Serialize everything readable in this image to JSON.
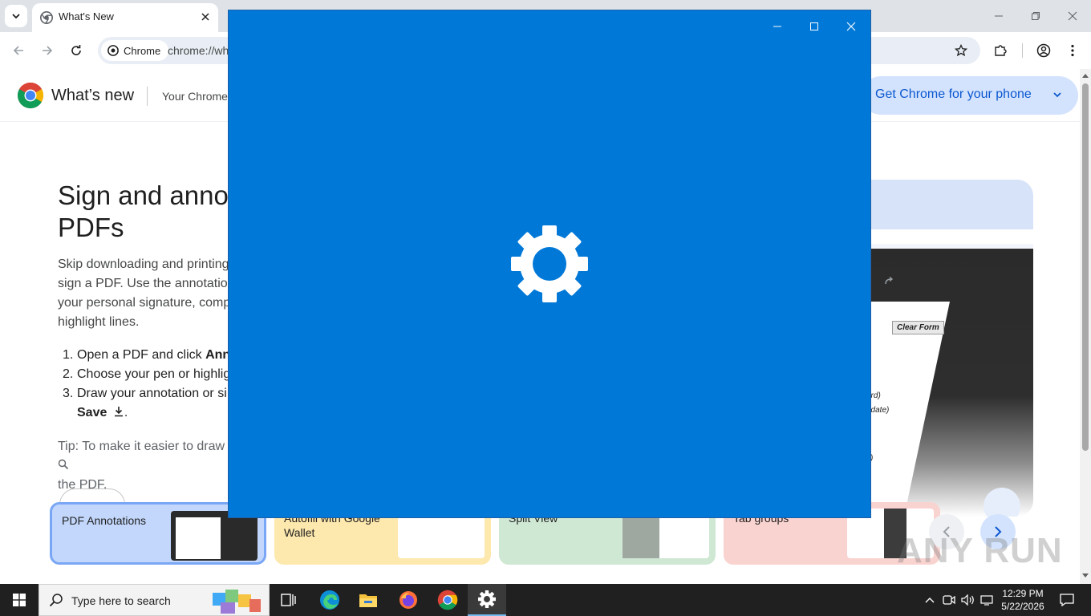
{
  "browser": {
    "tab_title": "What's New",
    "chip_label": "Chrome",
    "url": "chrome://wh"
  },
  "page": {
    "brand": "What’s new",
    "header_link": "Your Chrome",
    "phone_button": "Get Chrome for your phone",
    "heading_lines": [
      "Sign and annot",
      "PDFs"
    ],
    "paragraph_lines": [
      "Skip downloading and printing",
      "sign a PDF. Use the annotatio",
      "your personal signature, comp",
      "highlight lines."
    ],
    "steps": [
      {
        "num": "1.",
        "text": "Open a PDF and click ",
        "bold": "Ann"
      },
      {
        "num": "2.",
        "text": "Choose your pen or highlig",
        "bold": ""
      },
      {
        "num": "3.",
        "text": "Draw your annotation or si",
        "bold": ""
      }
    ],
    "step3_cont_bold": "Save",
    "step3_cont_after": ".",
    "tip_lines": [
      "Tip: To make it easier to draw",
      "the PDF."
    ],
    "illustration": {
      "clear_form": "Clear Form",
      "text1": "ord)",
      "text2": "t date)",
      "text3": "s)"
    },
    "cards": [
      {
        "label": "PDF Annotations"
      },
      {
        "label": "Autofill with Google Wallet"
      },
      {
        "label": "Split View"
      },
      {
        "label": "Tab groups"
      }
    ]
  },
  "watermark": "ANY RUN",
  "taskbar": {
    "search_placeholder": "Type here to search",
    "time": "12:29 PM",
    "date": "5/22/2026"
  },
  "colors": {
    "splash_bg": "#0078d7",
    "taskbar_bg": "#202020",
    "accent": "#0b57d0"
  }
}
